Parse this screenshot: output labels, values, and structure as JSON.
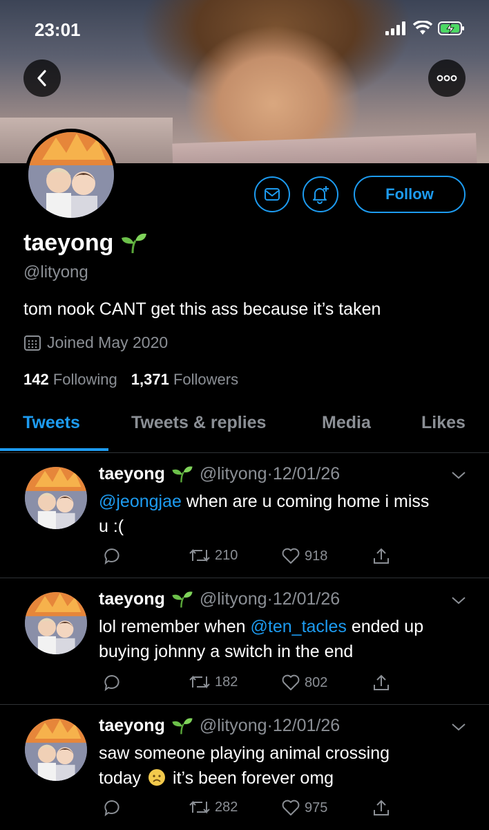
{
  "status_bar": {
    "time": "23:01"
  },
  "profile": {
    "display_name": "taeyong",
    "handle": "@lityong",
    "bio": "tom nook CANT get this ass because it’s taken",
    "joined": "Joined May 2020",
    "following_count": "142",
    "following_label": "Following",
    "followers_count": "1,371",
    "followers_label": "Followers",
    "follow_label": "Follow"
  },
  "tabs": [
    {
      "label": "Tweets",
      "active": true
    },
    {
      "label": "Tweets & replies",
      "active": false
    },
    {
      "label": "Media",
      "active": false
    },
    {
      "label": "Likes",
      "active": false
    }
  ],
  "tweets": [
    {
      "name": "taeyong",
      "handle": "@lityong",
      "date": "12/01/26",
      "mention": "@jeongjae",
      "text_line1": " when are u coming home i miss",
      "text_line2": "u :(",
      "retweets": "210",
      "likes": "918"
    },
    {
      "name": "taeyong",
      "handle": "@lityong",
      "date": "12/01/26",
      "text_before": "lol remember when ",
      "mention": "@ten_tacles",
      "text_after": " ended up",
      "text_line2": "buying johnny a switch in the end",
      "retweets": "182",
      "likes": "802"
    },
    {
      "name": "taeyong",
      "handle": "@lityong",
      "date": "12/01/26",
      "text_line1": "saw someone playing animal crossing",
      "text_line2_before": "today ",
      "text_line2_after": " it’s been forever omg",
      "retweets": "282",
      "likes": "975"
    }
  ],
  "colors": {
    "accent": "#1d9bf0",
    "muted": "#8b8f95",
    "sprout": "#6cc04a"
  }
}
